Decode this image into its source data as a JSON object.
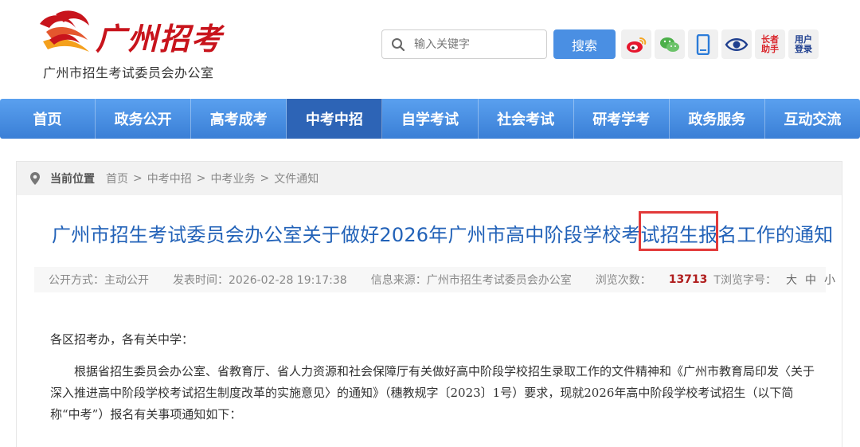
{
  "header": {
    "logo_title": "广州招考",
    "logo_subtitle": "广州市招生考试委员会办公室",
    "search_placeholder": "输入关键字",
    "search_button": "搜索",
    "tools": {
      "elder_label_1": "长者",
      "elder_label_2": "助手",
      "login_label_1": "用户",
      "login_label_2": "登录"
    }
  },
  "nav": {
    "items": [
      "首页",
      "政务公开",
      "高考成考",
      "中考中招",
      "自学考试",
      "社会考试",
      "研考学考",
      "政务服务",
      "互动交流"
    ],
    "active": "中考中招"
  },
  "breadcrumb": {
    "label": "当前位置",
    "items": [
      "首页",
      "中考中招",
      "中考业务",
      "文件通知"
    ]
  },
  "article": {
    "title": "广州市招生考试委员会办公室关于做好2026年广州市高中阶段学校考试招生报名工作的通知",
    "meta": {
      "disclosure": "公开方式：主动公开",
      "published": "发表时间：2026-02-28 19:17:38",
      "source": "信息来源：广州市招生考试委员会办公室",
      "views_label": "浏览次数：",
      "views_value": "13713",
      "font_label": "T浏览字号：",
      "font_large": "大",
      "font_medium": "中",
      "font_small": "小"
    },
    "greeting": "各区招考办，各有关中学：",
    "paragraph": "根据省招生委员会办公室、省教育厅、省人力资源和社会保障厅有关做好高中阶段学校招生录取工作的文件精神和《广州市教育局印发〈关于深入推进高中阶段学校考试招生制度改革的实施意见〉的通知》（穗教规字〔2023〕1号）要求，现就2026年高中阶段学校考试招生（以下简称“中考”）报名有关事项通知如下："
  },
  "colors": {
    "nav": "#3a7fd6",
    "nav_active": "#2d64b6",
    "title": "#2262b8",
    "brand_red": "#c8141c",
    "highlight": "#e23a3a"
  }
}
